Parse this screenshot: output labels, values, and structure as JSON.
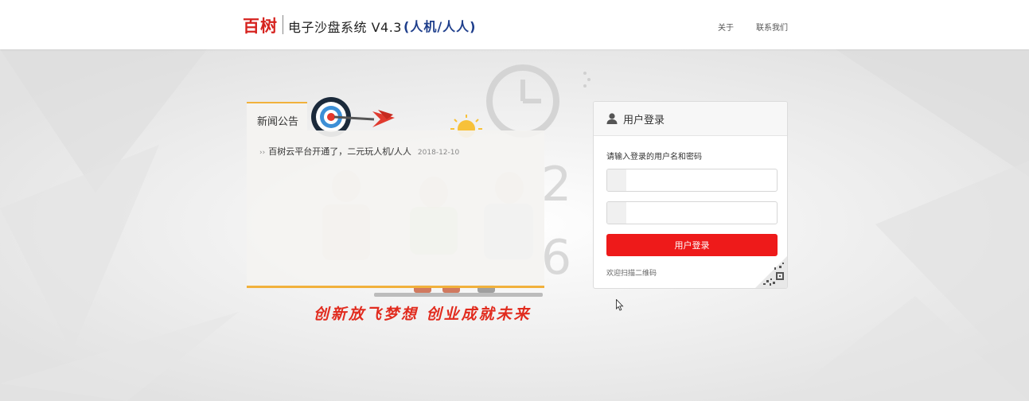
{
  "header": {
    "brand": "百树",
    "system_title": "电子沙盘系统 V4.3",
    "mode": "(人机/人人)",
    "nav": {
      "about": "关于",
      "contact": "联系我们"
    }
  },
  "news": {
    "tab_label": "新闻公告",
    "items": [
      {
        "bullet": "››",
        "title": "百树云平台开通了，二元玩人机/人人",
        "date": "2018-12-10"
      }
    ]
  },
  "slogan": "创新放飞梦想 创业成就未来",
  "login": {
    "title": "用户登录",
    "hint": "请输入登录的用户名和密码",
    "username": {
      "value": "",
      "placeholder": ""
    },
    "password": {
      "value": "",
      "placeholder": ""
    },
    "submit_label": "用户登录",
    "qr_text": "欢迎扫描二维码"
  },
  "colors": {
    "brand_red": "#d6231f",
    "mode_blue": "#1f3f8c",
    "button_red": "#ee1a1a",
    "accent_orange": "#f1b13c"
  },
  "icons": [
    "user-icon",
    "qr-code-icon",
    "target-icon",
    "dart-icon",
    "sun-icon",
    "clock-icon",
    "mouse-pointer-icon"
  ]
}
